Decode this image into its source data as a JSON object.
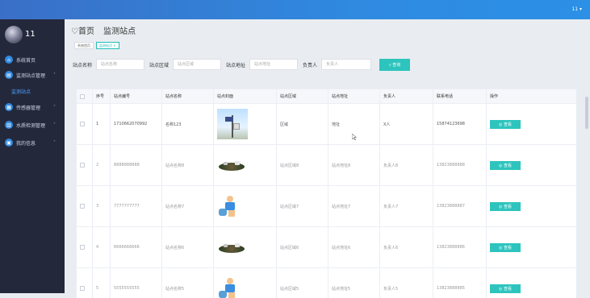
{
  "topbar": {
    "user_label": "11 ▾"
  },
  "sidebar": {
    "username": "11",
    "items": [
      {
        "label": "系统首页",
        "icon": "home-icon"
      },
      {
        "label": "监测站点管理",
        "icon": "station-icon",
        "expanded": true
      },
      {
        "label": "监测站点",
        "icon": ""
      },
      {
        "label": "传感器管理",
        "icon": "sensor-icon"
      },
      {
        "label": "水质检测管理",
        "icon": "water-icon"
      },
      {
        "label": "我的信息",
        "icon": "user-icon"
      }
    ],
    "active_sub": "监测站点"
  },
  "header": {
    "home": "♡首页",
    "crumb": "监测站点"
  },
  "tags": [
    {
      "label": "系统首页",
      "active": false
    },
    {
      "label": "监测站点 ×",
      "active": true
    }
  ],
  "filters": [
    {
      "label": "站点名称",
      "placeholder": "站点名称"
    },
    {
      "label": "站点区域",
      "placeholder": "站点区域"
    },
    {
      "label": "站点地址",
      "placeholder": "站点地址"
    },
    {
      "label": "负责人",
      "placeholder": "负责人"
    }
  ],
  "search_button": "⌕ 查询",
  "table": {
    "columns": [
      "序号",
      "站点编号",
      "站点名称",
      "站点封面",
      "站点区域",
      "站点地址",
      "负责人",
      "联系电话",
      "操作"
    ],
    "view_label": "◎ 查看",
    "rows": [
      {
        "no": "1",
        "code": "1710662070992",
        "name": "名称123",
        "cover": "photo",
        "region": "区域",
        "address": "地址",
        "owner": "X人",
        "phone": "15874123698",
        "dim": false
      },
      {
        "no": "2",
        "code": "8888888888",
        "name": "站点名称8",
        "cover": "trash",
        "region": "站点区域8",
        "address": "站点地址8",
        "owner": "负责人8",
        "phone": "13823888888",
        "dim": true
      },
      {
        "no": "3",
        "code": "7777777777",
        "name": "站点名称7",
        "cover": "kid",
        "region": "站点区域7",
        "address": "站点地址7",
        "owner": "负责人7",
        "phone": "13823888887",
        "dim": true
      },
      {
        "no": "4",
        "code": "6666666666",
        "name": "站点名称6",
        "cover": "trash",
        "region": "站点区域6",
        "address": "站点地址6",
        "owner": "负责人6",
        "phone": "13823888886",
        "dim": true
      },
      {
        "no": "5",
        "code": "5555555555",
        "name": "站点名称5",
        "cover": "kid",
        "region": "站点区域5",
        "address": "站点地址5",
        "owner": "负责人5",
        "phone": "13823888885",
        "dim": true
      }
    ]
  },
  "colors": {
    "accent": "#2ec4be",
    "sidebar": "#24283b",
    "topbar": "#2f8ae0"
  }
}
